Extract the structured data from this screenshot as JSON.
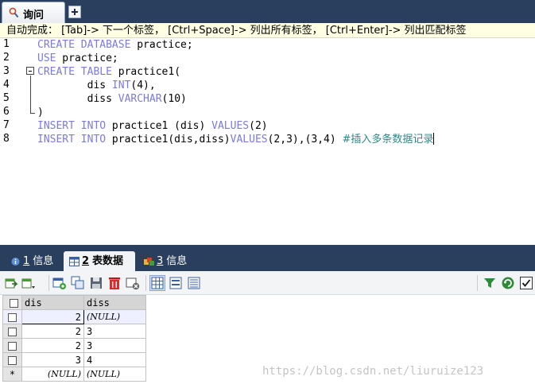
{
  "window": {
    "query_tab_label": "询问"
  },
  "hint": {
    "text": "自动完成： [Tab]-> 下一个标签， [Ctrl+Space]-> 列出所有标签， [Ctrl+Enter]-> 列出匹配标签"
  },
  "editor": {
    "line_numbers": [
      "1",
      "2",
      "3",
      "4",
      "5",
      "6",
      "7",
      "8"
    ],
    "lines": [
      {
        "segments": [
          {
            "t": "CREATE DATABASE",
            "k": "kw"
          },
          {
            "t": " practice;",
            "k": ""
          }
        ]
      },
      {
        "segments": [
          {
            "t": "USE",
            "k": "kw"
          },
          {
            "t": " practice;",
            "k": ""
          }
        ]
      },
      {
        "segments": [
          {
            "t": "CREATE TABLE",
            "k": "kw"
          },
          {
            "t": " practice1(",
            "k": ""
          }
        ]
      },
      {
        "segments": [
          {
            "t": "        dis ",
            "k": ""
          },
          {
            "t": "INT",
            "k": "kw"
          },
          {
            "t": "(4),",
            "k": ""
          }
        ]
      },
      {
        "segments": [
          {
            "t": "        diss ",
            "k": ""
          },
          {
            "t": "VARCHAR",
            "k": "kw"
          },
          {
            "t": "(10)",
            "k": ""
          }
        ]
      },
      {
        "segments": [
          {
            "t": ")",
            "k": ""
          }
        ]
      },
      {
        "segments": [
          {
            "t": "INSERT INTO",
            "k": "kw"
          },
          {
            "t": " practice1 (dis) ",
            "k": ""
          },
          {
            "t": "VALUES",
            "k": "kw"
          },
          {
            "t": "(2)",
            "k": ""
          }
        ]
      },
      {
        "segments": [
          {
            "t": "INSERT INTO",
            "k": "kw"
          },
          {
            "t": " practice1(dis,diss)",
            "k": ""
          },
          {
            "t": "VALUES",
            "k": "kw"
          },
          {
            "t": "(2,3),(3,4) ",
            "k": ""
          },
          {
            "t": "#插入多条数据记录",
            "k": "cm"
          }
        ]
      }
    ]
  },
  "result_tabs": [
    {
      "num": "1",
      "label": "信息",
      "icon": "info-icon"
    },
    {
      "num": "2",
      "label": "表数据",
      "icon": "table-data-icon",
      "active": true
    },
    {
      "num": "3",
      "label": "信息",
      "icon": "info-icon"
    }
  ],
  "toolbar": {
    "icons": [
      "export-icon",
      "import-dropdown-icon",
      "add-row-icon",
      "duplicate-row-icon",
      "save-icon",
      "delete-icon",
      "cancel-icon",
      "grid-view-icon",
      "form-view-icon",
      "text-view-icon",
      "filter-icon",
      "refresh-icon",
      "checkbox-icon"
    ]
  },
  "grid": {
    "columns": [
      "dis",
      "diss"
    ],
    "rows": [
      {
        "marker": "",
        "dis": "2",
        "diss": "(NULL)"
      },
      {
        "marker": "",
        "dis": "2",
        "diss": "3"
      },
      {
        "marker": "",
        "dis": "2",
        "diss": "3"
      },
      {
        "marker": "",
        "dis": "3",
        "diss": "4"
      },
      {
        "marker": "*",
        "dis": "(NULL)",
        "diss": "(NULL)"
      }
    ]
  },
  "watermark": "https://blog.csdn.net/liuruize123",
  "colors": {
    "keyword": "#7a7adf",
    "comment": "#2d8a8a",
    "chrome": "#2a3f5e"
  }
}
